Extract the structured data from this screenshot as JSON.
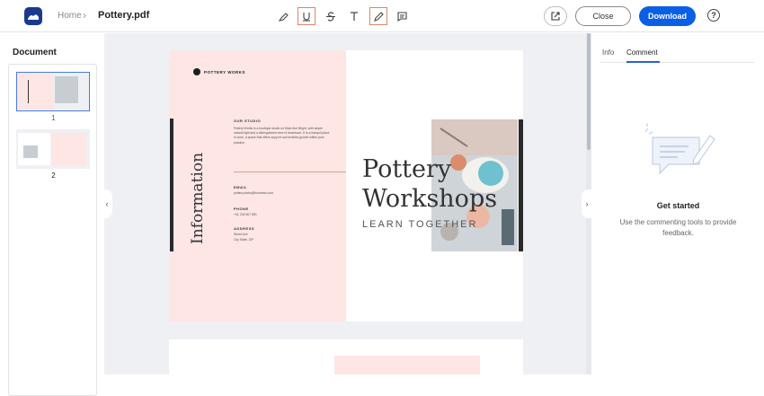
{
  "header": {
    "breadcrumb_home": "Home",
    "breadcrumb_sep": "›",
    "file_name": "Pottery.pdf",
    "close_label": "Close",
    "download_label": "Download",
    "help_glyph": "?"
  },
  "toolbar": {
    "tools": [
      "highlight-icon",
      "underline-icon",
      "strikethrough-icon",
      "text-icon",
      "pencil-icon",
      "comment-icon"
    ],
    "active_tools": [
      "underline-icon",
      "pencil-icon"
    ]
  },
  "sidebar": {
    "title": "Document",
    "pages": [
      {
        "number": "1",
        "selected": true
      },
      {
        "number": "2",
        "selected": false
      }
    ]
  },
  "document": {
    "page1": {
      "left_title": "Information",
      "our_studio_heading": "OUR STUDIO",
      "our_studio_text": "Pottery Works is a boutique studio on Main Ave Bright, with ample natural light and a distinguished view of downtown. It is a tranquil place to work, a space that offers support and enables growth within your practice.",
      "email_heading": "EMAIL",
      "email_value": "pottery.works@business.com",
      "phone_heading": "PHONE",
      "phone_value": "+01 234 567 890",
      "address_heading": "ADDRESS",
      "address_line1": "Street Ave",
      "address_line2": "City State, ZIP",
      "brand": "POTTERY WORKS",
      "headline_line1": "Pottery",
      "headline_line2": "Workshops",
      "tagline": "LEARN TOGETHER"
    }
  },
  "comments_panel": {
    "tab_info": "Info",
    "tab_comment": "Comment",
    "active_tab": "Comment",
    "empty_title": "Get started",
    "empty_text": "Use the commenting tools to provide feedback."
  },
  "colors": {
    "accent": "#0a5fe6",
    "active_tool_border": "#d9886a",
    "page_pink": "#fde6e4",
    "canvas_bg": "#eef0f4"
  }
}
